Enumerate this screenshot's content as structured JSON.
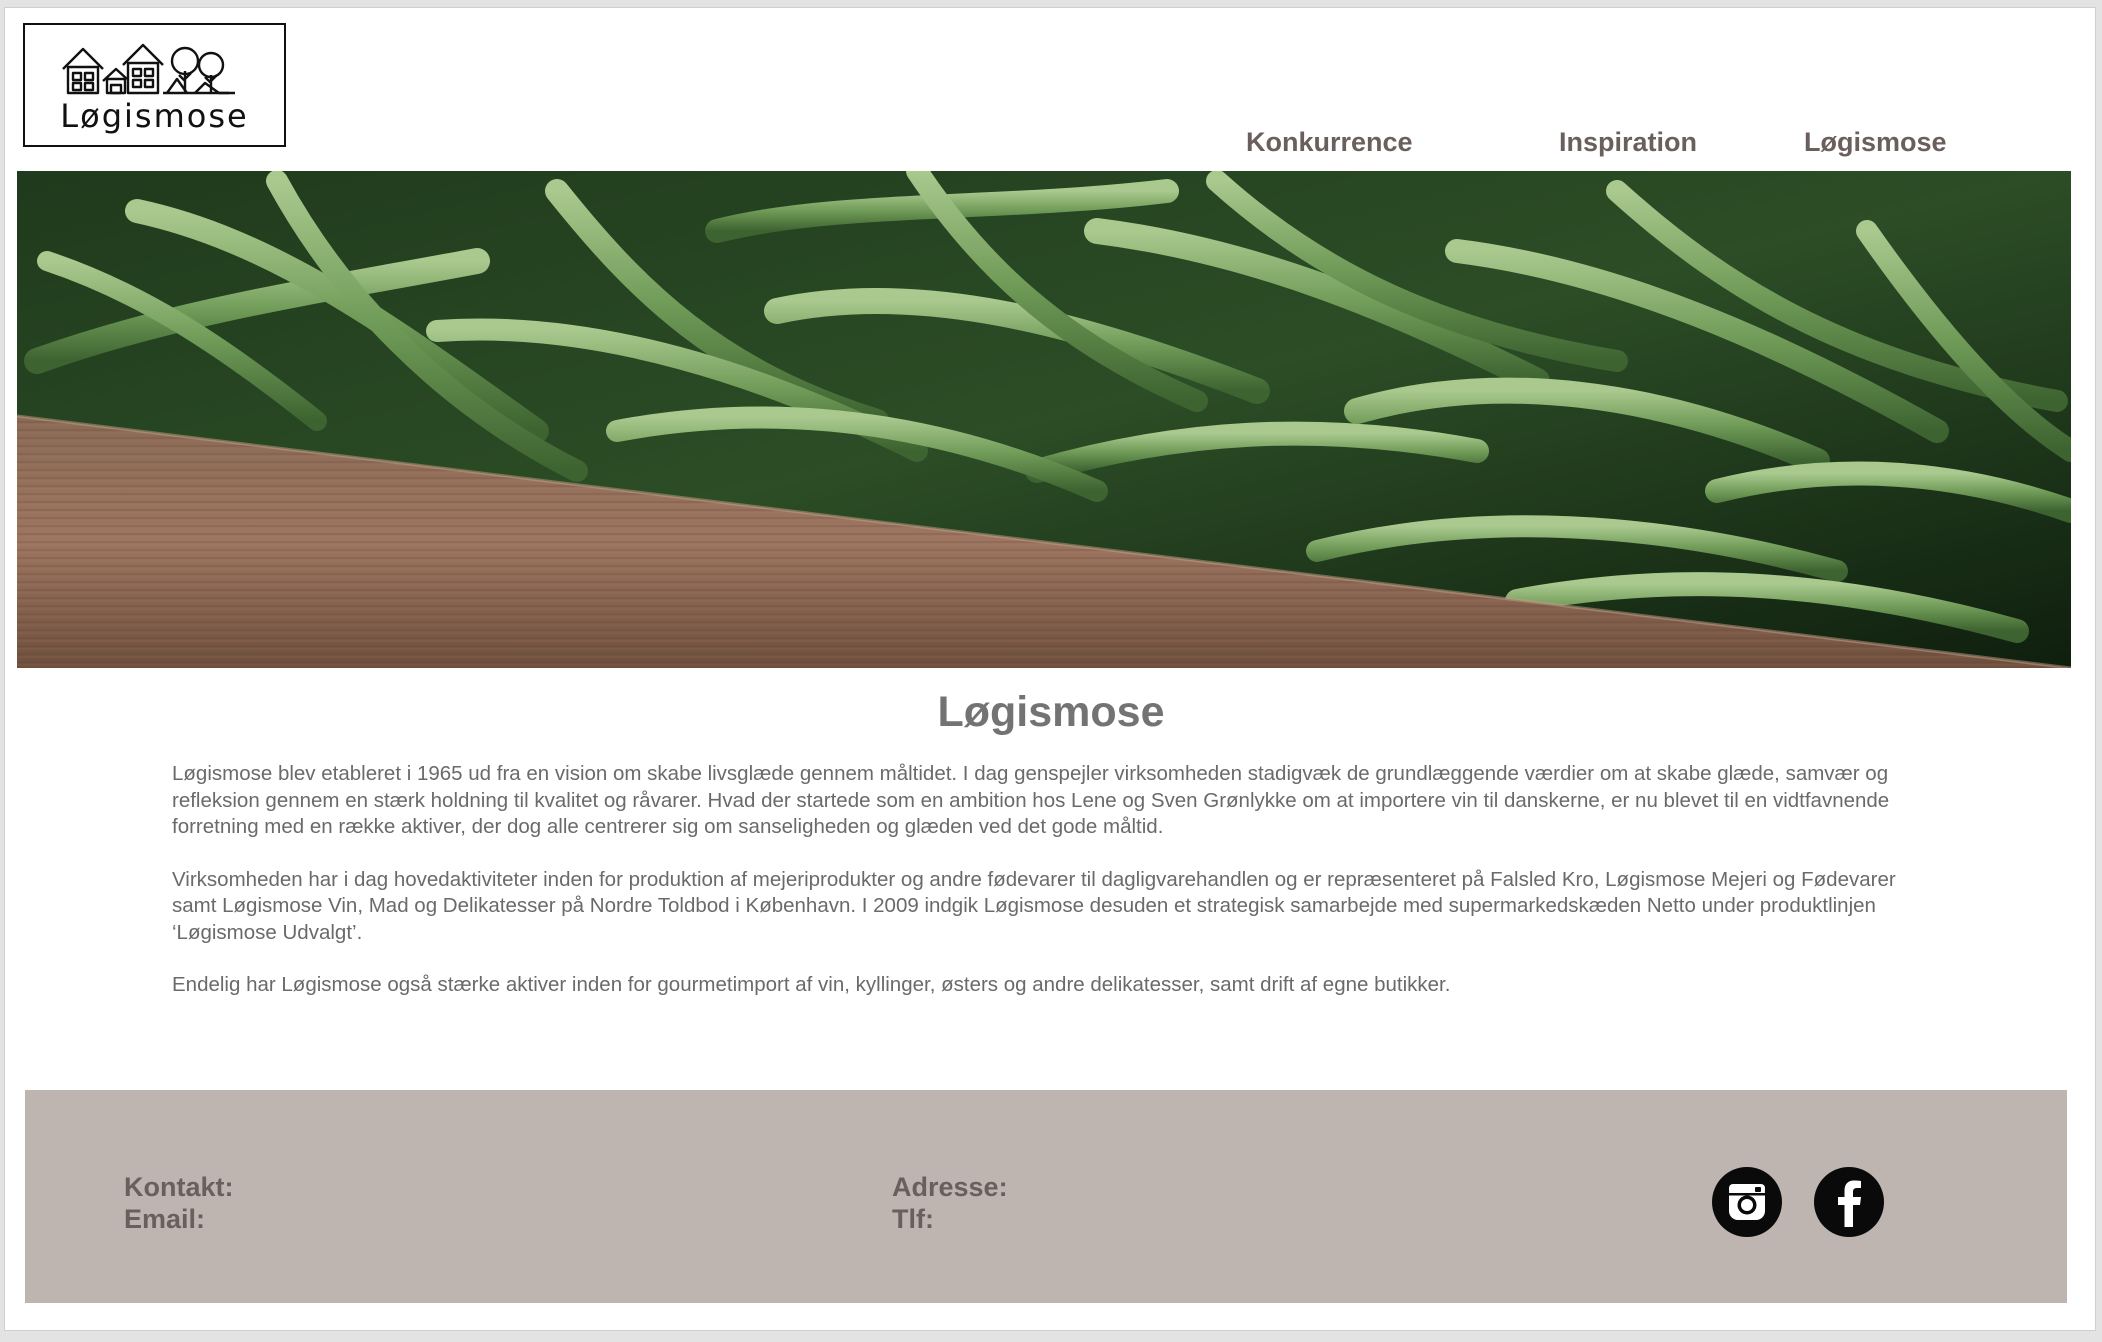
{
  "logo": {
    "text": "Løgismose",
    "icon": "houses-trees-icon"
  },
  "nav": {
    "items": [
      {
        "label": "Konkurrence"
      },
      {
        "label": "Inspiration"
      },
      {
        "label": "Løgismose"
      }
    ]
  },
  "hero": {
    "image": "green-beans-in-wooden-crate"
  },
  "main": {
    "title": "Løgismose",
    "paragraphs": [
      "Løgismose blev etableret i 1965 ud fra en vision om skabe livsglæde gennem måltidet. I dag genspejler virksomheden stadigvæk de grundlæggende værdier om at skabe glæde, samvær og refleksion gennem en stærk holdning til kvalitet og råvarer. Hvad der startede som en ambition hos Lene og Sven Grønlykke om at importere vin til danskerne, er nu blevet til en vidtfavnende forretning med en række aktiver, der dog alle centrerer sig om sanseligheden og glæden ved det gode måltid.",
      "Virksomheden har i dag hovedaktiviteter inden for produktion af mejeriprodukter og andre fødevarer til dagligvarehandlen og er repræsenteret på Falsled Kro, Løgismose Mejeri og Fødevarer samt Løgismose Vin, Mad og Delikatesser på Nordre Toldbod i København. I 2009 indgik Løgismose desuden et strategisk samarbejde med supermarkedskæden Netto under produktlinjen ‘Løgismose Udvalgt’.",
      "Endelig har Løgismose også stærke aktiver inden for gourmetimport af vin, kyllinger, østers og andre delikatesser, samt drift af egne butikker."
    ]
  },
  "footer": {
    "contact_label": "Kontakt:",
    "email_label": "Email:",
    "address_label": "Adresse:",
    "phone_label": "Tlf:",
    "social": [
      "instagram-icon",
      "facebook-icon"
    ]
  },
  "colors": {
    "nav_text": "#6b5f5d",
    "footer_bg": "#bfb5b0",
    "body_text": "#6a6a6a",
    "title_text": "#737373"
  }
}
